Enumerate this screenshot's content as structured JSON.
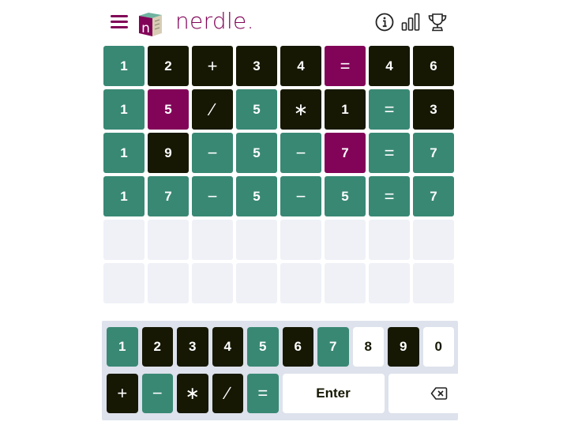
{
  "header": {
    "logo_text": "nerdle.",
    "cube_letter": "n",
    "menu_icon": "hamburger-menu-icon",
    "info_icon": "info-icon",
    "stats_icon": "bar-chart-icon",
    "trophy_icon": "trophy-icon"
  },
  "colors": {
    "green": "#398874",
    "black": "#161803",
    "purple": "#820458",
    "empty": "#eff1f7",
    "keyboard_bg": "#dde2ec"
  },
  "board": {
    "rows": [
      [
        {
          "v": "1",
          "s": "green"
        },
        {
          "v": "2",
          "s": "black"
        },
        {
          "v": "+",
          "s": "black"
        },
        {
          "v": "3",
          "s": "black"
        },
        {
          "v": "4",
          "s": "black"
        },
        {
          "v": "=",
          "s": "purple"
        },
        {
          "v": "4",
          "s": "black"
        },
        {
          "v": "6",
          "s": "black"
        }
      ],
      [
        {
          "v": "1",
          "s": "green"
        },
        {
          "v": "5",
          "s": "purple"
        },
        {
          "v": "∕",
          "s": "black"
        },
        {
          "v": "5",
          "s": "green"
        },
        {
          "v": "∗",
          "s": "black"
        },
        {
          "v": "1",
          "s": "black"
        },
        {
          "v": "=",
          "s": "green"
        },
        {
          "v": "3",
          "s": "black"
        }
      ],
      [
        {
          "v": "1",
          "s": "green"
        },
        {
          "v": "9",
          "s": "black"
        },
        {
          "v": "−",
          "s": "green"
        },
        {
          "v": "5",
          "s": "green"
        },
        {
          "v": "−",
          "s": "green"
        },
        {
          "v": "7",
          "s": "purple"
        },
        {
          "v": "=",
          "s": "green"
        },
        {
          "v": "7",
          "s": "green"
        }
      ],
      [
        {
          "v": "1",
          "s": "green"
        },
        {
          "v": "7",
          "s": "green"
        },
        {
          "v": "−",
          "s": "green"
        },
        {
          "v": "5",
          "s": "green"
        },
        {
          "v": "−",
          "s": "green"
        },
        {
          "v": "5",
          "s": "green"
        },
        {
          "v": "=",
          "s": "green"
        },
        {
          "v": "7",
          "s": "green"
        }
      ],
      [
        {
          "v": "",
          "s": "empty"
        },
        {
          "v": "",
          "s": "empty"
        },
        {
          "v": "",
          "s": "empty"
        },
        {
          "v": "",
          "s": "empty"
        },
        {
          "v": "",
          "s": "empty"
        },
        {
          "v": "",
          "s": "empty"
        },
        {
          "v": "",
          "s": "empty"
        },
        {
          "v": "",
          "s": "empty"
        }
      ],
      [
        {
          "v": "",
          "s": "empty"
        },
        {
          "v": "",
          "s": "empty"
        },
        {
          "v": "",
          "s": "empty"
        },
        {
          "v": "",
          "s": "empty"
        },
        {
          "v": "",
          "s": "empty"
        },
        {
          "v": "",
          "s": "empty"
        },
        {
          "v": "",
          "s": "empty"
        },
        {
          "v": "",
          "s": "empty"
        }
      ]
    ]
  },
  "keyboard": {
    "digits": [
      {
        "k": "1",
        "s": "green"
      },
      {
        "k": "2",
        "s": "black"
      },
      {
        "k": "3",
        "s": "black"
      },
      {
        "k": "4",
        "s": "black"
      },
      {
        "k": "5",
        "s": "green"
      },
      {
        "k": "6",
        "s": "black"
      },
      {
        "k": "7",
        "s": "green"
      },
      {
        "k": "8",
        "s": "white"
      },
      {
        "k": "9",
        "s": "black"
      },
      {
        "k": "0",
        "s": "white"
      }
    ],
    "operators": [
      {
        "k": "+",
        "s": "black",
        "name": "plus"
      },
      {
        "k": "−",
        "s": "green",
        "name": "minus"
      },
      {
        "k": "∗",
        "s": "black",
        "name": "multiply"
      },
      {
        "k": "∕",
        "s": "black",
        "name": "divide"
      },
      {
        "k": "=",
        "s": "green",
        "name": "equals"
      }
    ],
    "enter_label": "Enter",
    "backspace_icon": "backspace-icon"
  }
}
